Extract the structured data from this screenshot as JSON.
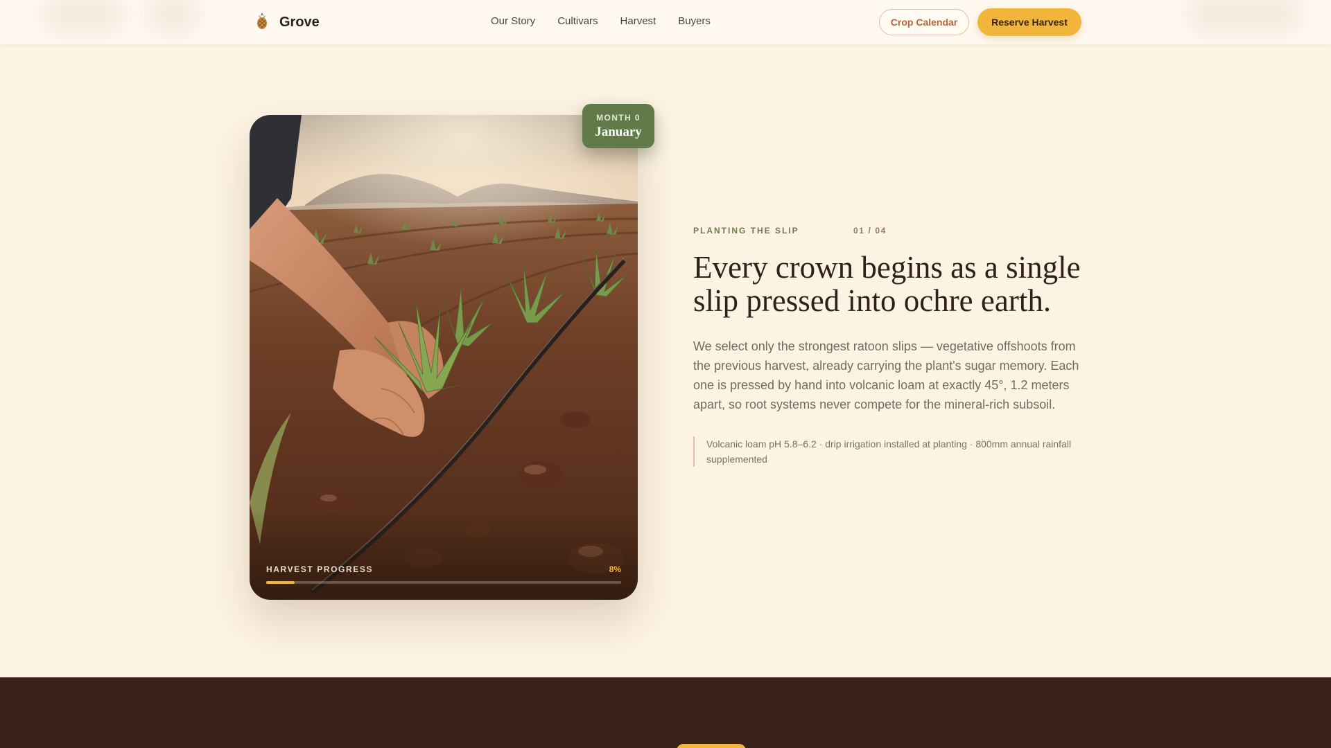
{
  "header": {
    "brand": {
      "name": "Grove",
      "logo_icon": "pineapple-icon"
    },
    "nav": [
      "Our Story",
      "Cultivars",
      "Harvest",
      "Buyers"
    ],
    "secondary_cta": "Crop Calendar",
    "primary_cta": "Reserve Harvest"
  },
  "hero": {
    "badge": {
      "label": "MONTH 0",
      "month": "January"
    },
    "progress": {
      "label": "HARVEST PROGRESS",
      "value_text": "8%",
      "value": 0.08
    },
    "eyebrow": "PLANTING THE SLIP",
    "step": "01 / 04",
    "headline": "Every crown begins as a single slip pressed into ochre earth.",
    "body": "We select only the strongest ratoon slips — vegetative offshoots from the previous harvest, already carrying the plant's sugar memory. Each one is pressed by hand into volcanic loam at exactly 45°, 1.2 meters apart, so root systems never compete for the mineral-rich subsoil.",
    "note": "Volcanic loam pH 5.8–6.2 · drip irrigation installed at planting · 800mm annual rainfall supplemented"
  },
  "colors": {
    "background": "#fdf3e3",
    "accent": "#f2b53c",
    "badge": "#627a4a",
    "footer_band": "#3b2218"
  }
}
